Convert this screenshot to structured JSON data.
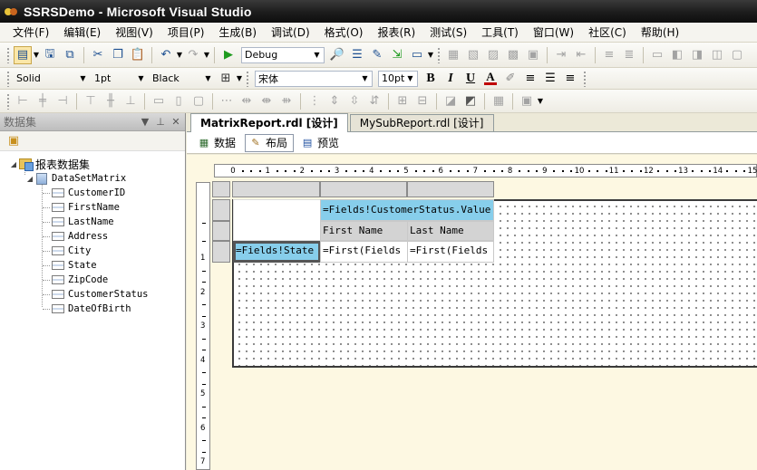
{
  "window": {
    "title": "SSRSDemo - Microsoft Visual Studio"
  },
  "menu": [
    "文件(F)",
    "编辑(E)",
    "视图(V)",
    "项目(P)",
    "生成(B)",
    "调试(D)",
    "格式(O)",
    "报表(R)",
    "测试(S)",
    "工具(T)",
    "窗口(W)",
    "社区(C)",
    "帮助(H)"
  ],
  "toolbar": {
    "config": "Debug",
    "line_style": "Solid",
    "line_width": "1pt",
    "line_color": "Black",
    "font_name": "宋体",
    "font_size": "10pt"
  },
  "icons": {
    "bold": "B",
    "italic": "I",
    "underline": "U",
    "font_color": "A"
  },
  "datasets_panel": {
    "title": "数据集",
    "root": "报表数据集",
    "dataset": "DataSetMatrix",
    "fields": [
      "CustomerID",
      "FirstName",
      "LastName",
      "Address",
      "City",
      "State",
      "ZipCode",
      "CustomerStatus",
      "DateOfBirth"
    ]
  },
  "doc_tabs": [
    "MatrixReport.rdl [设计]",
    "MySubReport.rdl [设计]"
  ],
  "sub_tabs": [
    "数据",
    "布局",
    "预览"
  ],
  "ruler": {
    "top": [
      "0",
      "1",
      "2",
      "3",
      "4",
      "5",
      "6",
      "7",
      "8",
      "9",
      "10",
      "11",
      "12",
      "13",
      "14",
      "15"
    ],
    "left": [
      "1",
      "2",
      "3",
      "4",
      "5",
      "6",
      "7"
    ]
  },
  "matrix": {
    "col_group": "=Fields!CustomerStatus.Value",
    "col_header_1": "First Name",
    "col_header_2": "Last Name",
    "row_group": "=Fields!State",
    "detail_1": "=First(Fields",
    "detail_2": "=First(Fields"
  }
}
